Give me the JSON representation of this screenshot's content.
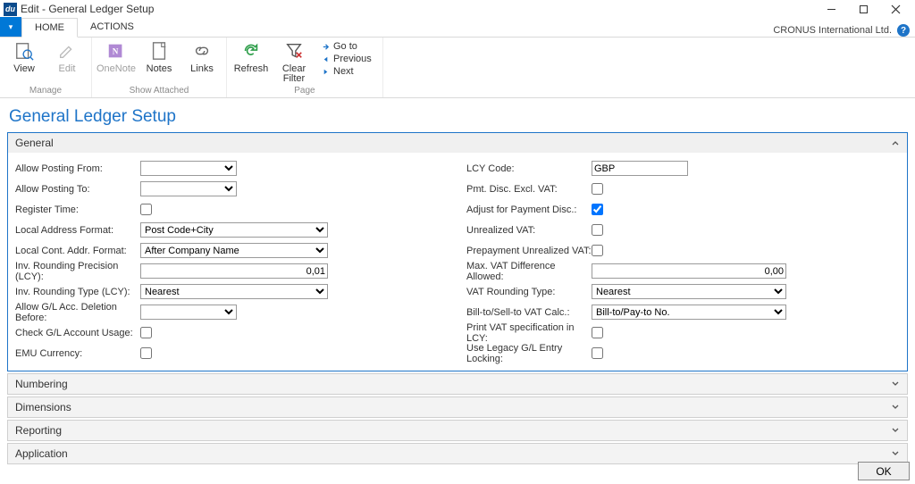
{
  "window": {
    "title": "Edit - General Ledger Setup"
  },
  "company": "CRONUS International Ltd.",
  "tabs": {
    "home": "HOME",
    "actions": "ACTIONS"
  },
  "ribbon": {
    "manage": {
      "label": "Manage",
      "view": "View",
      "edit": "Edit"
    },
    "show": {
      "label": "Show Attached",
      "onenote": "OneNote",
      "notes": "Notes",
      "links": "Links"
    },
    "page": {
      "label": "Page",
      "refresh": "Refresh",
      "clear": "Clear\nFilter",
      "goto": "Go to",
      "prev": "Previous",
      "next": "Next"
    }
  },
  "page_title": "General Ledger Setup",
  "fasttabs": {
    "general": "General",
    "numbering": "Numbering",
    "dimensions": "Dimensions",
    "reporting": "Reporting",
    "application": "Application"
  },
  "left": {
    "allow_from": "Allow Posting From:",
    "allow_to": "Allow Posting To:",
    "register_time": "Register Time:",
    "local_addr": "Local Address Format:",
    "local_addr_val": "Post Code+City",
    "local_cont": "Local Cont. Addr. Format:",
    "local_cont_val": "After Company Name",
    "inv_prec": "Inv. Rounding Precision (LCY):",
    "inv_prec_val": "0,01",
    "inv_type": "Inv. Rounding Type (LCY):",
    "inv_type_val": "Nearest",
    "allow_gl_del": "Allow G/L Acc. Deletion Before:",
    "check_gl": "Check G/L Account Usage:",
    "emu": "EMU Currency:"
  },
  "right": {
    "lcy": "LCY Code:",
    "lcy_val": "GBP",
    "pmt_disc": "Pmt. Disc. Excl. VAT:",
    "adj_pmt": "Adjust for Payment Disc.:",
    "adj_pmt_val": true,
    "unreal_vat": "Unrealized VAT:",
    "prepay": "Prepayment Unrealized VAT:",
    "max_vat": "Max. VAT Difference Allowed:",
    "max_vat_val": "0,00",
    "vat_round": "VAT Rounding Type:",
    "vat_round_val": "Nearest",
    "bill_sell": "Bill-to/Sell-to VAT Calc.:",
    "bill_sell_val": "Bill-to/Pay-to No.",
    "print_vat": "Print VAT specification in LCY:",
    "legacy": "Use Legacy G/L Entry Locking:"
  },
  "footer": {
    "ok": "OK"
  }
}
